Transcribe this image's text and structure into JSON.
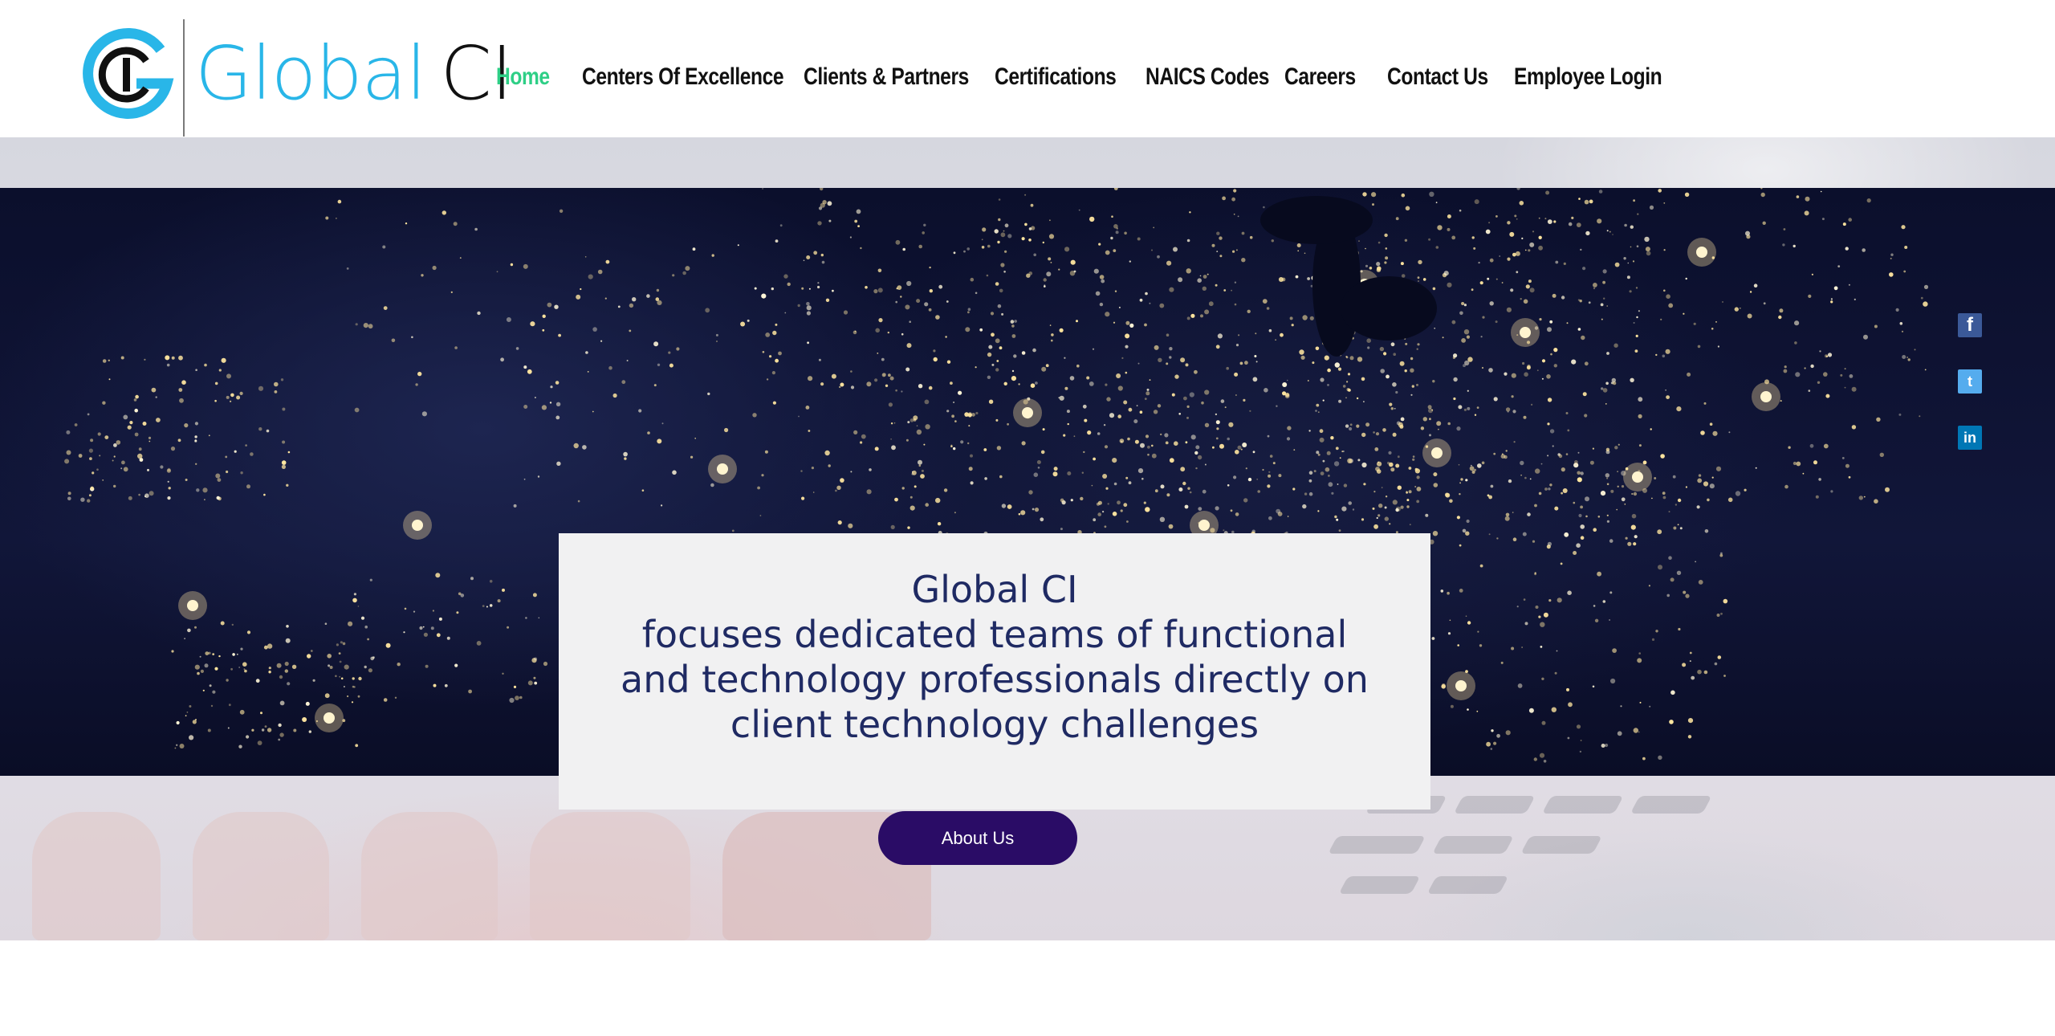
{
  "brand": {
    "logo_primary": "Global",
    "logo_secondary": "CI",
    "logo_mark_text": "CI",
    "colors": {
      "blue": "#29b6e8",
      "black": "#111111"
    }
  },
  "nav": {
    "items": [
      {
        "label": "Home",
        "active": true
      },
      {
        "label": "Centers Of Excellence",
        "active": false
      },
      {
        "label": "Clients & Partners",
        "active": false
      },
      {
        "label": "Certifications",
        "active": false
      },
      {
        "label": "NAICS Codes",
        "active": false
      },
      {
        "label": "Careers",
        "active": false
      },
      {
        "label": "Contact Us",
        "active": false
      },
      {
        "label": "Employee Login",
        "active": false
      }
    ],
    "active_color": "#2ecf86"
  },
  "hero": {
    "title": "Global CI",
    "lines": [
      "focuses dedicated teams of functional",
      "and technology professionals directly on",
      "client technology challenges"
    ],
    "button_label": "About Us",
    "text_color": "#1f2a63",
    "button_color": "#2a0c66"
  },
  "social": [
    {
      "name": "facebook",
      "glyph": "f",
      "color": "#3b5998"
    },
    {
      "name": "twitter",
      "glyph": "t",
      "color": "#55acee"
    },
    {
      "name": "linkedin",
      "glyph": "in",
      "color": "#0077b5"
    }
  ]
}
